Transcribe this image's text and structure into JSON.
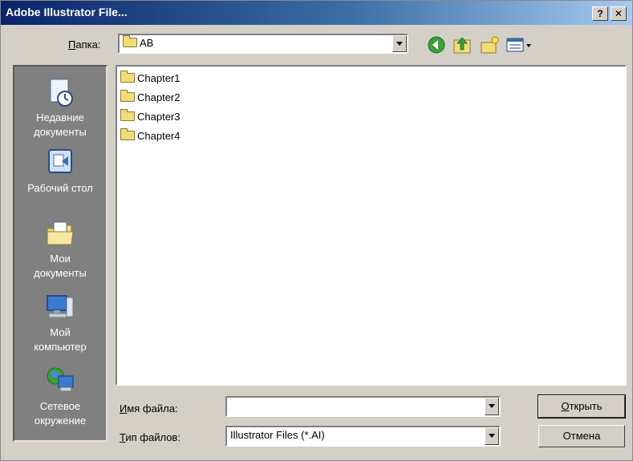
{
  "window": {
    "title": "Adobe Illustrator File...",
    "help_label": "?",
    "close_label": "✕"
  },
  "folder": {
    "label_hotkey": "П",
    "label_rest": "апка:",
    "value": "AB"
  },
  "places": [
    {
      "line1": "Недавние",
      "line2": "документы",
      "icon": "recent-documents-icon"
    },
    {
      "line1": "Рабочий стол",
      "line2": "",
      "icon": "desktop-icon"
    },
    {
      "line1": "Мои",
      "line2": "документы",
      "icon": "my-documents-icon"
    },
    {
      "line1": "Мой",
      "line2": "компьютер",
      "icon": "my-computer-icon"
    },
    {
      "line1": "Сетевое",
      "line2": "окружение",
      "icon": "network-places-icon"
    }
  ],
  "files": [
    {
      "name": "Chapter1"
    },
    {
      "name": "Chapter2"
    },
    {
      "name": "Chapter3"
    },
    {
      "name": "Chapter4"
    }
  ],
  "filename": {
    "label_hotkey": "И",
    "label_rest": "мя файла:",
    "value": ""
  },
  "filetype": {
    "label_hotkey": "Т",
    "label_rest": "ип файлов:",
    "value": "Illustrator Files (*.AI)"
  },
  "buttons": {
    "open_hotkey": "О",
    "open_rest": "ткрыть",
    "cancel": "Отмена"
  },
  "colors": {
    "title_gradient_start": "#0a246a",
    "places_bg": "#808080",
    "dialog_bg": "#d4d0c8"
  }
}
